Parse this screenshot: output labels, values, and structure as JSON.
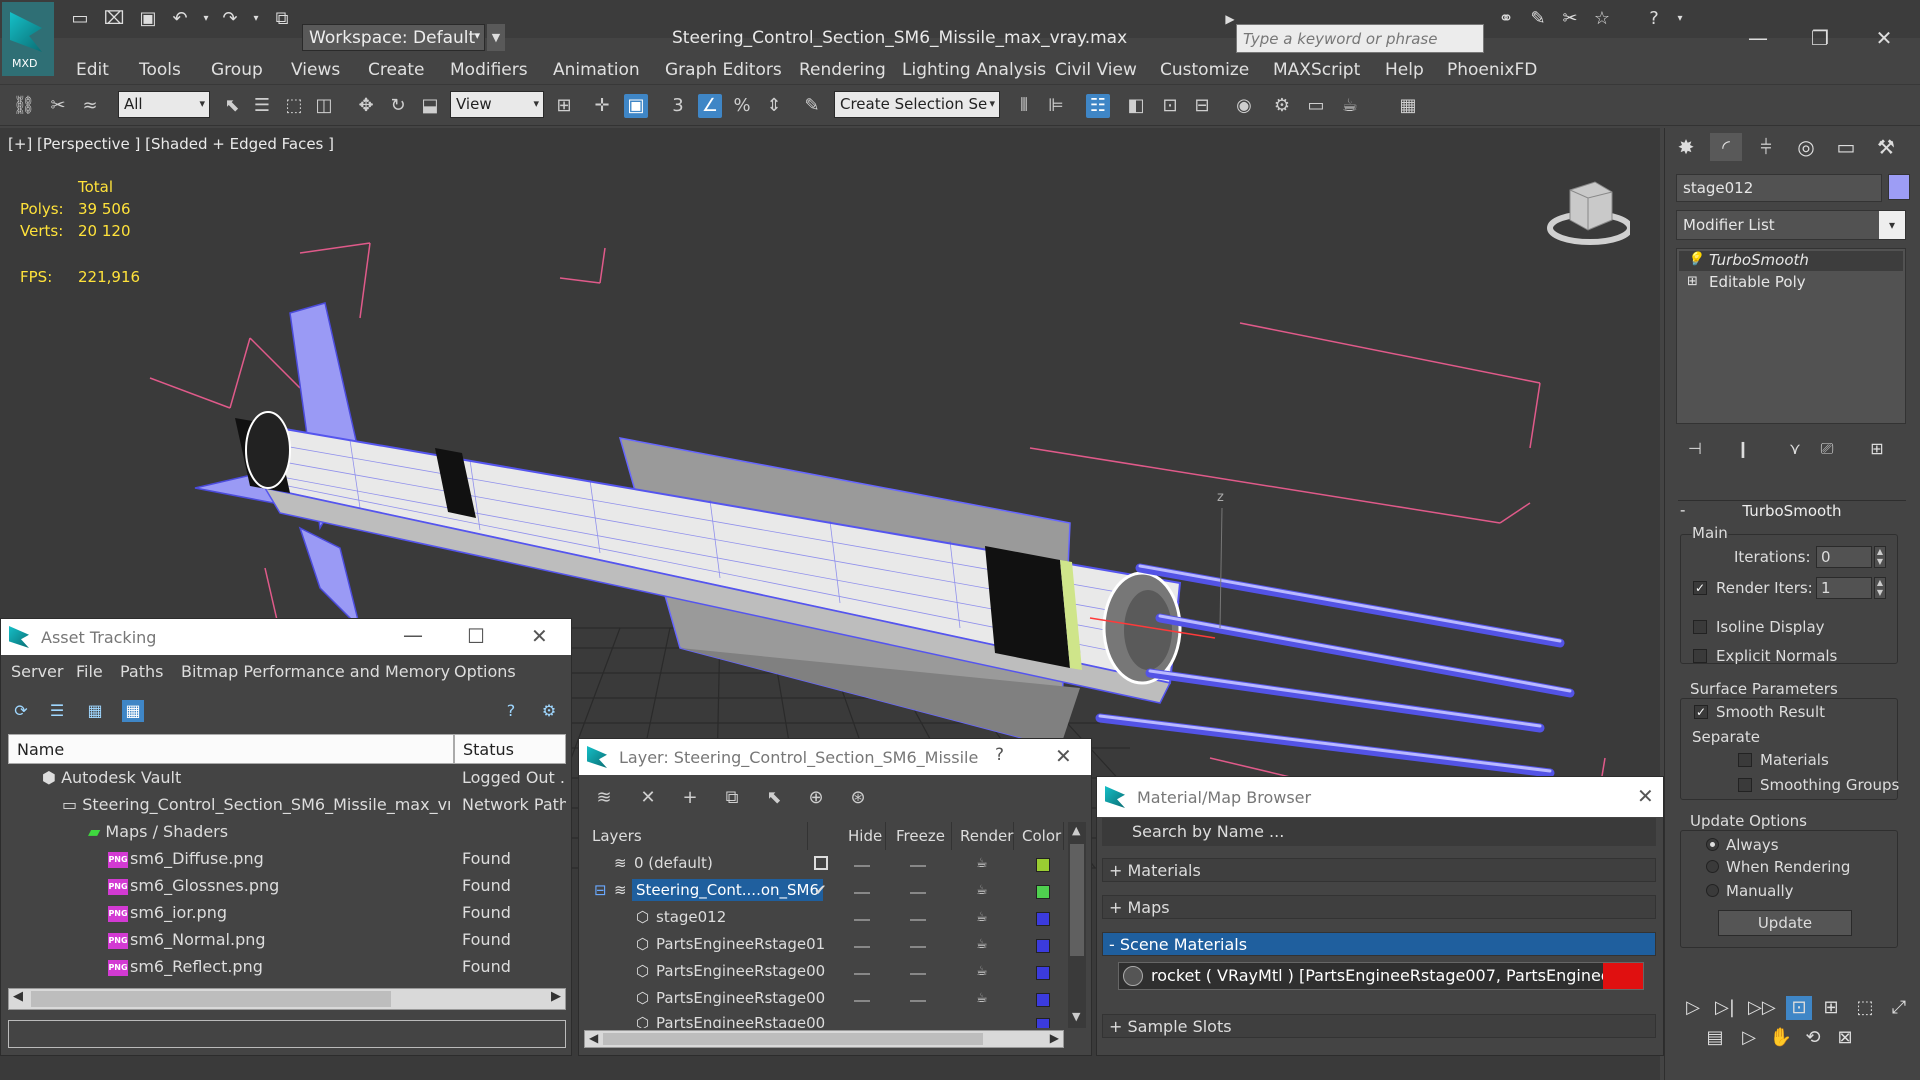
{
  "app": {
    "logo_text": "MXD",
    "workspace": "Workspace: Default",
    "doc_title": "Steering_Control_Section_SM6_Missile_max_vray.max",
    "search_placeholder": "Type a keyword or phrase"
  },
  "menu": [
    "Edit",
    "Tools",
    "Group",
    "Views",
    "Create",
    "Modifiers",
    "Animation",
    "Graph Editors",
    "Rendering",
    "Lighting Analysis",
    "Civil View",
    "Customize",
    "MAXScript",
    "Help",
    "PhoenixFD"
  ],
  "toolbar": {
    "filter": "All",
    "ref_coord": "View",
    "selection_set": "Create Selection Se"
  },
  "viewport": {
    "label": "[+] [Perspective ] [Shaded + Edged Faces ]",
    "stats": {
      "total_label": "Total",
      "polys_label": "Polys:",
      "polys_value": "39 506",
      "verts_label": "Verts:",
      "verts_value": "20 120",
      "fps_label": "FPS:",
      "fps_value": "221,916"
    },
    "axis_label": "z"
  },
  "command_panel": {
    "object_name": "stage012",
    "object_color": "#9d9df5",
    "modifier_list": "Modifier List",
    "stack": [
      "TurboSmooth",
      "Editable Poly"
    ],
    "rollout_title": "TurboSmooth",
    "main_label": "Main",
    "iterations_label": "Iterations:",
    "iterations_value": "0",
    "render_iters_label": "Render Iters:",
    "render_iters_value": "1",
    "isoline_label": "Isoline Display",
    "explicit_normals_label": "Explicit Normals",
    "surface_params_label": "Surface Parameters",
    "smooth_result_label": "Smooth Result",
    "separate_label": "Separate",
    "materials_label": "Materials",
    "smoothing_groups_label": "Smoothing Groups",
    "update_options_label": "Update Options",
    "always_label": "Always",
    "when_rendering_label": "When Rendering",
    "manually_label": "Manually",
    "update_button": "Update"
  },
  "asset_tracking": {
    "title": "Asset Tracking",
    "menu": [
      "Server",
      "File",
      "Paths",
      "Bitmap Performance and Memory",
      "Options"
    ],
    "col_name": "Name",
    "col_status": "Status",
    "rows": [
      {
        "name": "Autodesk Vault",
        "status": "Logged Out ..."
      },
      {
        "name": "Steering_Control_Section_SM6_Missile_max_vr...",
        "status": "Network Path"
      },
      {
        "name": "Maps / Shaders",
        "status": ""
      },
      {
        "name": "sm6_Diffuse.png",
        "status": "Found"
      },
      {
        "name": "sm6_Glossnes.png",
        "status": "Found"
      },
      {
        "name": "sm6_ior.png",
        "status": "Found"
      },
      {
        "name": "sm6_Normal.png",
        "status": "Found"
      },
      {
        "name": "sm6_Reflect.png",
        "status": "Found"
      }
    ],
    "png_tag": "PNG"
  },
  "layer_window": {
    "title": "Layer: Steering_Control_Section_SM6_Missile",
    "help": "?",
    "cols": [
      "Layers",
      "Hide",
      "Freeze",
      "Render",
      "Color"
    ],
    "rows": [
      {
        "name": "0 (default)",
        "color": "#9acd32"
      },
      {
        "name": "Steering_Cont....on_SM6",
        "color": "#4fd04f"
      },
      {
        "name": "stage012",
        "color": "#3b3bdd"
      },
      {
        "name": "PartsEngineeRstage01",
        "color": "#3b3bdd"
      },
      {
        "name": "PartsEngineeRstage00",
        "color": "#3b3bdd"
      },
      {
        "name": "PartsEngineeRstage00",
        "color": "#3b3bdd"
      },
      {
        "name": "PartsEngineeRstage00",
        "color": "#3b3bdd"
      }
    ]
  },
  "material_browser": {
    "title": "Material/Map Browser",
    "search_placeholder": "Search by Name ...",
    "sections": [
      "+ Materials",
      "+ Maps",
      "- Scene Materials",
      "+ Sample Slots"
    ],
    "material_entry": "rocket  ( VRayMtl ) [PartsEngineeRstage007, PartsEngineeRstage0..."
  }
}
